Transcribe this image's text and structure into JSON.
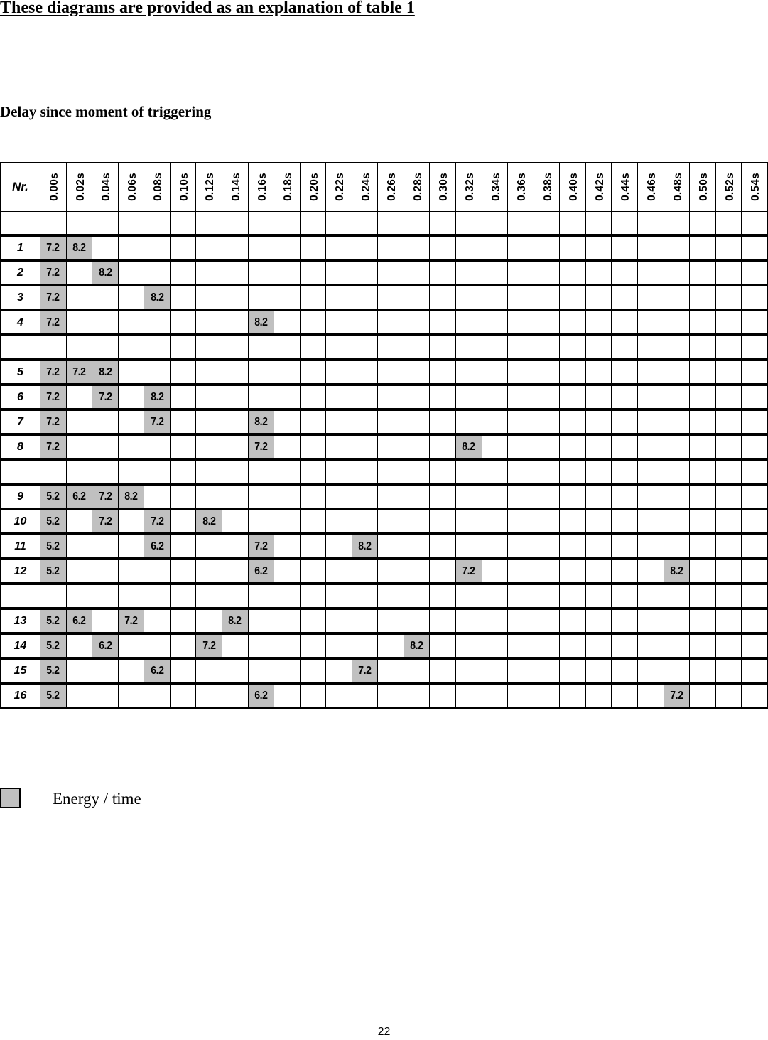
{
  "title": "These diagrams are provided as an explanation of table 1",
  "subtitle": "Delay since moment of triggering",
  "table": {
    "nr_header": "Nr.",
    "columns": [
      "0.00s",
      "0.02s",
      "0.04s",
      "0.06s",
      "0.08s",
      "0.10s",
      "0.12s",
      "0.14s",
      "0.16s",
      "0.18s",
      "0.20s",
      "0.22s",
      "0.24s",
      "0.26s",
      "0.28s",
      "0.30s",
      "0.32s",
      "0.34s",
      "0.36s",
      "0.38s",
      "0.40s",
      "0.42s",
      "0.44s",
      "0.46s",
      "0.48s",
      "0.50s",
      "0.52s",
      "0.54s"
    ],
    "rows": [
      {
        "spacer": true
      },
      {
        "nr": "1",
        "cells": {
          "0.00s": "7.2",
          "0.02s": "8.2"
        }
      },
      {
        "nr": "2",
        "cells": {
          "0.00s": "7.2",
          "0.04s": "8.2"
        }
      },
      {
        "nr": "3",
        "cells": {
          "0.00s": "7.2",
          "0.08s": "8.2"
        }
      },
      {
        "nr": "4",
        "cells": {
          "0.00s": "7.2",
          "0.16s": "8.2"
        }
      },
      {
        "spacer": true
      },
      {
        "nr": "5",
        "cells": {
          "0.00s": "7.2",
          "0.02s": "7.2",
          "0.04s": "8.2"
        }
      },
      {
        "nr": "6",
        "cells": {
          "0.00s": "7.2",
          "0.04s": "7.2",
          "0.08s": "8.2"
        }
      },
      {
        "nr": "7",
        "cells": {
          "0.00s": "7.2",
          "0.08s": "7.2",
          "0.16s": "8.2"
        }
      },
      {
        "nr": "8",
        "cells": {
          "0.00s": "7.2",
          "0.16s": "7.2",
          "0.32s": "8.2"
        }
      },
      {
        "spacer": true
      },
      {
        "nr": "9",
        "cells": {
          "0.00s": "5.2",
          "0.02s": "6.2",
          "0.04s": "7.2",
          "0.06s": "8.2"
        }
      },
      {
        "nr": "10",
        "cells": {
          "0.00s": "5.2",
          "0.04s": "7.2",
          "0.08s": "7.2",
          "0.12s": "8.2"
        }
      },
      {
        "nr": "11",
        "cells": {
          "0.00s": "5.2",
          "0.08s": "6.2",
          "0.16s": "7.2",
          "0.24s": "8.2"
        }
      },
      {
        "nr": "12",
        "cells": {
          "0.00s": "5.2",
          "0.16s": "6.2",
          "0.32s": "7.2",
          "0.48s": "8.2"
        }
      },
      {
        "spacer": true
      },
      {
        "nr": "13",
        "cells": {
          "0.00s": "5.2",
          "0.02s": "6.2",
          "0.06s": "7.2",
          "0.14s": "8.2"
        }
      },
      {
        "nr": "14",
        "cells": {
          "0.00s": "5.2",
          "0.04s": "6.2",
          "0.12s": "7.2",
          "0.28s": "8.2"
        }
      },
      {
        "nr": "15",
        "cells": {
          "0.00s": "5.2",
          "0.08s": "6.2",
          "0.24s": "7.2"
        }
      },
      {
        "nr": "16",
        "cells": {
          "0.00s": "5.2",
          "0.16s": "6.2",
          "0.48s": "7.2"
        }
      }
    ]
  },
  "legend": {
    "label": "Energy / time",
    "swatch_color": "#c0c0c0"
  },
  "page_number": "22"
}
